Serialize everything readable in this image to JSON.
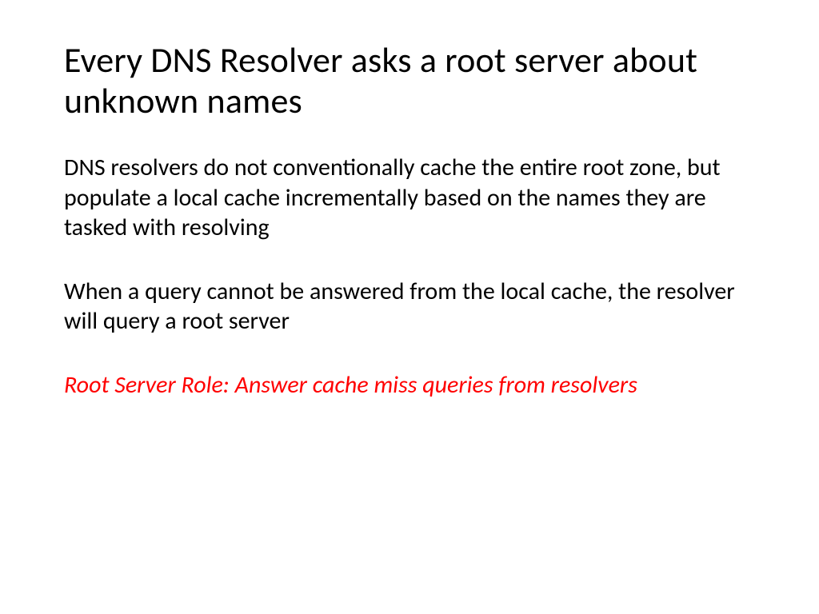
{
  "slide": {
    "title": "Every DNS Resolver asks a root server about unknown names",
    "paragraph1": "DNS resolvers do not conventionally cache the entire root zone, but populate a local cache incrementally based on the names they are tasked with resolving",
    "paragraph2": "When a query cannot be answered from the local cache, the resolver will query a root server",
    "highlight": "Root Server Role: Answer cache miss queries from resolvers"
  }
}
